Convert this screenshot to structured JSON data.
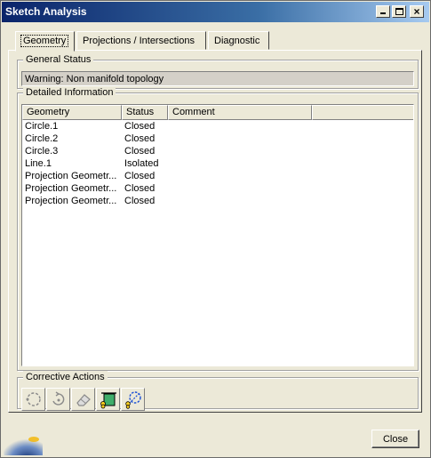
{
  "window": {
    "title": "Sketch Analysis"
  },
  "tabs": [
    {
      "label": "Geometry",
      "active": true
    },
    {
      "label": "Projections / Intersections",
      "active": false
    },
    {
      "label": "Diagnostic",
      "active": false
    }
  ],
  "general_status": {
    "title": "General Status",
    "value": "Warning: Non manifold topology"
  },
  "detailed_info": {
    "title": "Detailed Information",
    "columns": [
      "Geometry",
      "Status",
      "Comment"
    ],
    "rows": [
      {
        "geometry": "Circle.1",
        "status": "Closed",
        "comment": ""
      },
      {
        "geometry": "Circle.2",
        "status": "Closed",
        "comment": ""
      },
      {
        "geometry": "Circle.3",
        "status": "Closed",
        "comment": ""
      },
      {
        "geometry": "Line.1",
        "status": "Isolated",
        "comment": ""
      },
      {
        "geometry": "Projection Geometr...",
        "status": "Closed",
        "comment": ""
      },
      {
        "geometry": "Projection Geometr...",
        "status": "Closed",
        "comment": ""
      },
      {
        "geometry": "Projection Geometr...",
        "status": "Closed",
        "comment": ""
      }
    ]
  },
  "corrective_actions": {
    "title": "Corrective Actions",
    "icons": [
      "open-circle-icon",
      "rotate-icon",
      "eraser-icon",
      "construction-geometry-icon",
      "show-hide-icon"
    ]
  },
  "footer": {
    "close_label": "Close"
  }
}
